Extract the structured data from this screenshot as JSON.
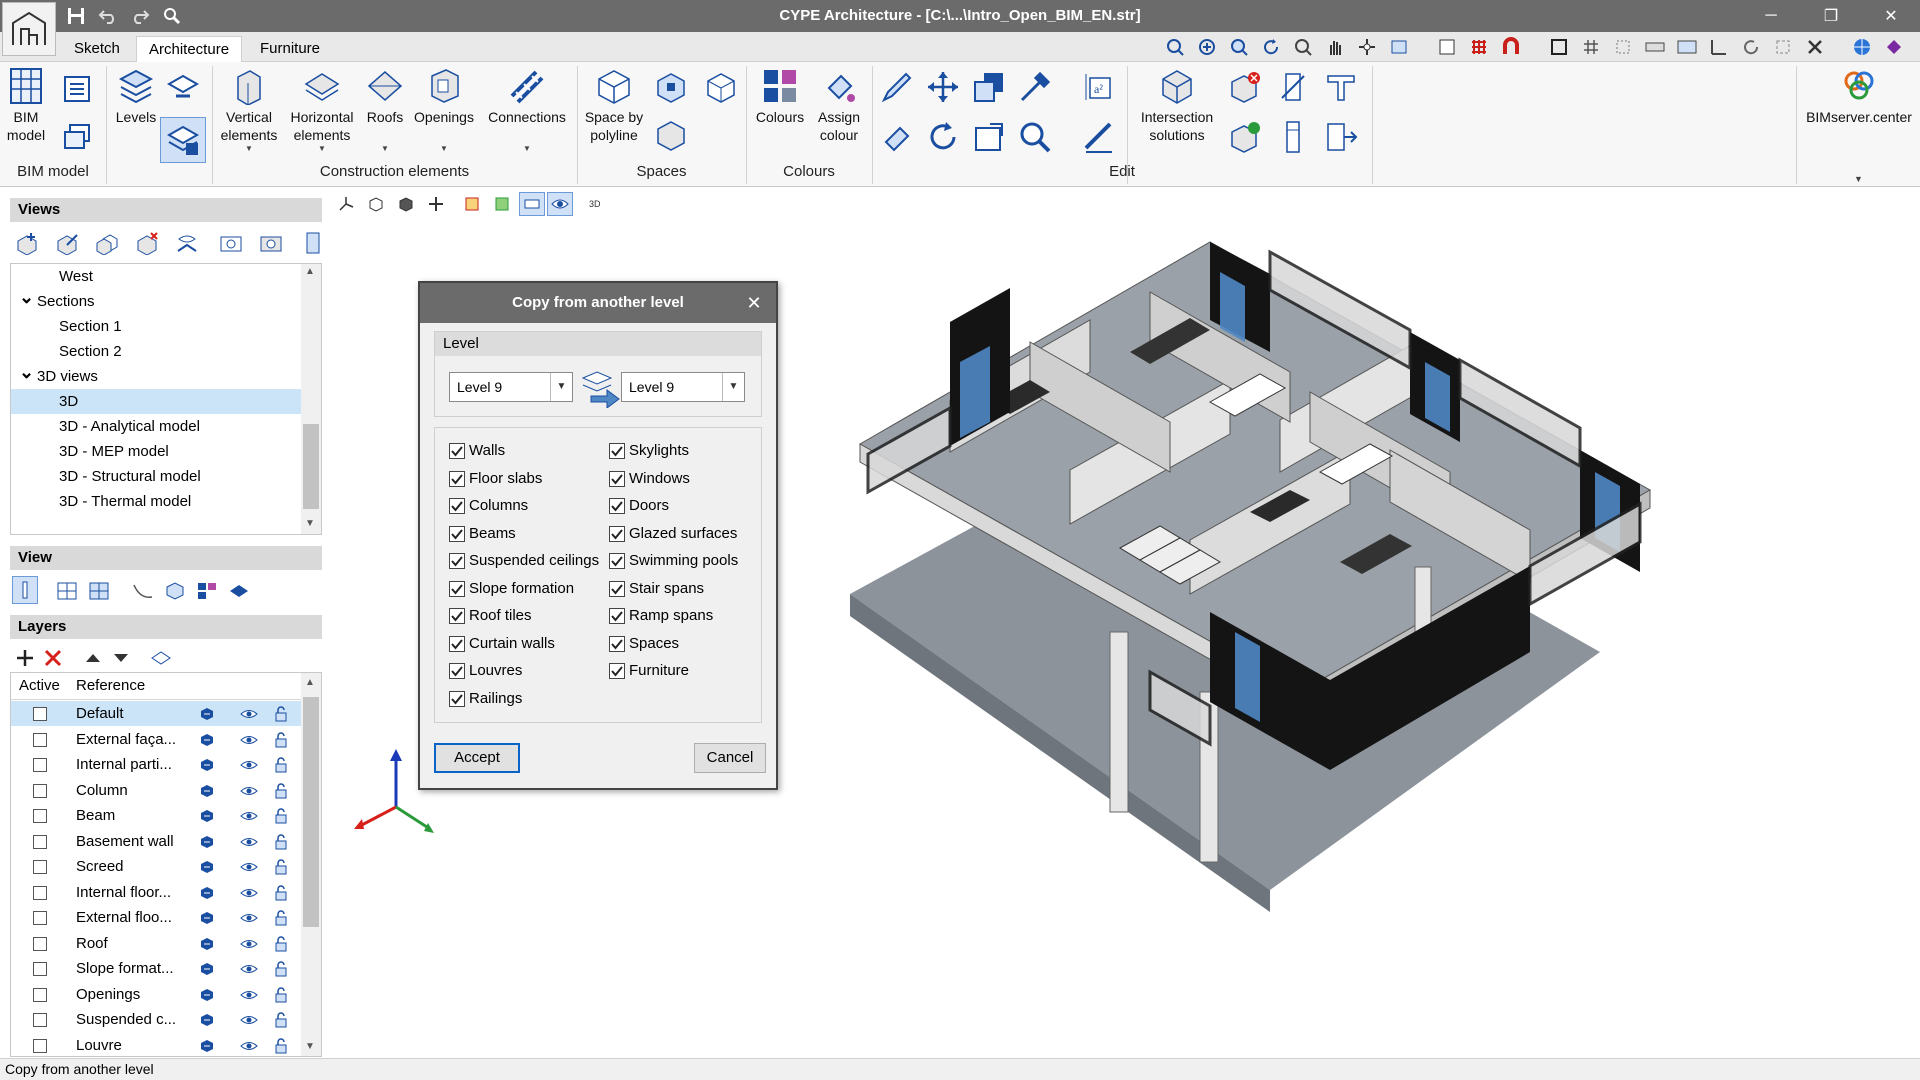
{
  "window": {
    "title": "CYPE Architecture - [C:\\...\\Intro_Open_BIM_EN.str]",
    "min": "─",
    "restore": "❐",
    "close": "✕"
  },
  "tabs": [
    {
      "label": "Sketch",
      "active": false
    },
    {
      "label": "Architecture",
      "active": true
    },
    {
      "label": "Furniture",
      "active": false
    }
  ],
  "ribbon": {
    "bim_model": "BIM\nmodel",
    "levels": "Levels",
    "vertical_elements": "Vertical\nelements",
    "horizontal_elements": "Horizontal\nelements",
    "roofs": "Roofs",
    "openings": "Openings",
    "connections": "Connections",
    "space_by_polyline": "Space by\npolyline",
    "colours": "Colours",
    "assign_colour": "Assign\ncolour",
    "intersection_solutions": "Intersection\nsolutions",
    "bimserver": "BIMserver.center",
    "groups": {
      "bim_model": "BIM model",
      "construction": "Construction elements",
      "spaces": "Spaces",
      "colours": "Colours",
      "edit": "Edit"
    }
  },
  "views_panel": {
    "title": "Views",
    "items": [
      {
        "label": "West",
        "indent": 2,
        "selected": false,
        "group": false
      },
      {
        "label": "Sections",
        "indent": 1,
        "selected": false,
        "group": true
      },
      {
        "label": "Section 1",
        "indent": 2,
        "selected": false,
        "group": false
      },
      {
        "label": "Section 2",
        "indent": 2,
        "selected": false,
        "group": false
      },
      {
        "label": "3D views",
        "indent": 1,
        "selected": false,
        "group": true
      },
      {
        "label": "3D",
        "indent": 2,
        "selected": true,
        "group": false
      },
      {
        "label": "3D - Analytical model",
        "indent": 2,
        "selected": false,
        "group": false
      },
      {
        "label": "3D - MEP model",
        "indent": 2,
        "selected": false,
        "group": false
      },
      {
        "label": "3D - Structural model",
        "indent": 2,
        "selected": false,
        "group": false
      },
      {
        "label": "3D - Thermal model",
        "indent": 2,
        "selected": false,
        "group": false
      }
    ]
  },
  "view_panel": {
    "title": "View"
  },
  "layers_panel": {
    "title": "Layers",
    "col_active": "Active",
    "col_reference": "Reference",
    "rows": [
      {
        "name": "Default",
        "selected": true
      },
      {
        "name": "External faça...",
        "selected": false
      },
      {
        "name": "Internal parti...",
        "selected": false
      },
      {
        "name": "Column",
        "selected": false
      },
      {
        "name": "Beam",
        "selected": false
      },
      {
        "name": "Basement wall",
        "selected": false
      },
      {
        "name": "Screed",
        "selected": false
      },
      {
        "name": "Internal floor...",
        "selected": false
      },
      {
        "name": "External floo...",
        "selected": false
      },
      {
        "name": "Roof",
        "selected": false
      },
      {
        "name": "Slope format...",
        "selected": false
      },
      {
        "name": "Openings",
        "selected": false
      },
      {
        "name": "Suspended c...",
        "selected": false
      },
      {
        "name": "Louvre",
        "selected": false
      }
    ]
  },
  "dialog": {
    "title": "Copy from another level",
    "close": "✕",
    "level_group": "Level",
    "from_level": "Level 9",
    "to_level": "Level 9",
    "options_left": [
      {
        "label": "Walls",
        "checked": true
      },
      {
        "label": "Floor slabs",
        "checked": true
      },
      {
        "label": "Columns",
        "checked": true
      },
      {
        "label": "Beams",
        "checked": true
      },
      {
        "label": "Suspended ceilings",
        "checked": true
      },
      {
        "label": "Slope formation",
        "checked": true
      },
      {
        "label": "Roof tiles",
        "checked": true
      },
      {
        "label": "Curtain walls",
        "checked": true
      },
      {
        "label": "Louvres",
        "checked": true
      },
      {
        "label": "Railings",
        "checked": true
      }
    ],
    "options_right": [
      {
        "label": "Skylights",
        "checked": true
      },
      {
        "label": "Windows",
        "checked": true
      },
      {
        "label": "Doors",
        "checked": true
      },
      {
        "label": "Glazed surfaces",
        "checked": true
      },
      {
        "label": "Swimming pools",
        "checked": true
      },
      {
        "label": "Stair spans",
        "checked": true
      },
      {
        "label": "Ramp spans",
        "checked": true
      },
      {
        "label": "Spaces",
        "checked": true
      },
      {
        "label": "Furniture",
        "checked": true
      }
    ],
    "accept": "Accept",
    "cancel": "Cancel"
  },
  "status": {
    "text": "Copy from another level"
  },
  "colors": {
    "titlebar": "#6b6b6b",
    "accent": "#0a64c8",
    "selection": "#cce4f7",
    "slab": "#8c939b",
    "wall_dark": "#141414",
    "glass": "#4f87c4"
  }
}
